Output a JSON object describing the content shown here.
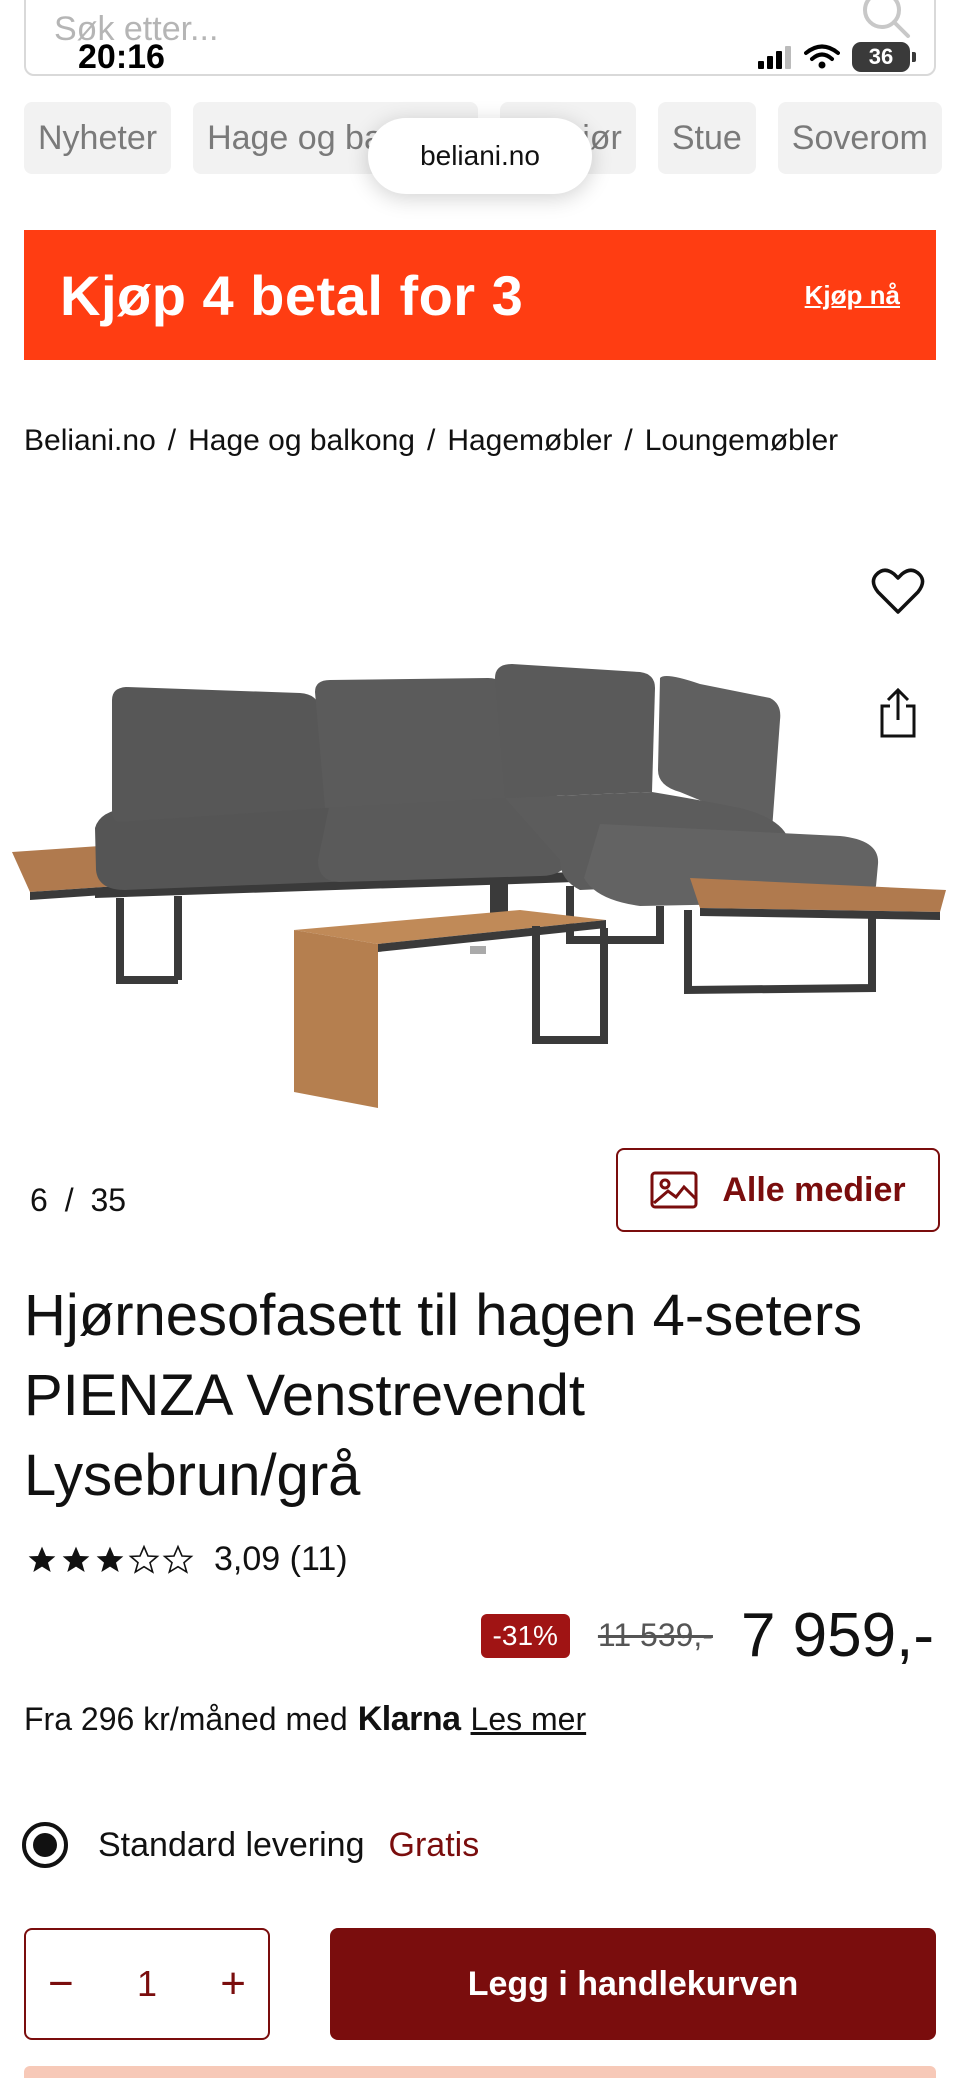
{
  "status_bar": {
    "time": "20:16",
    "battery": "36"
  },
  "search": {
    "placeholder": "Søk etter..."
  },
  "url_pill": "beliani.no",
  "categories": [
    "Nyheter",
    "Hage og balkong",
    "Interiør",
    "Stue",
    "Soverom"
  ],
  "promo": {
    "title": "Kjøp 4 betal for 3",
    "link": "Kjøp nå",
    "color": "#ff3d12"
  },
  "breadcrumb": [
    "Beliani.no",
    "Hage og balkong",
    "Hagemøbler",
    "Loungemøbler"
  ],
  "gallery": {
    "current": "6",
    "total": "35",
    "separator": "/",
    "media_label": "Alle medier"
  },
  "product": {
    "title": "Hjørnesofasett til hagen 4-seters PIENZA Venstrevendt Lysebrun/grå",
    "rating": {
      "value_text": "3,09 (11)",
      "stars": 3.09,
      "max": 5
    },
    "discount": "-31%",
    "old_price": "11 539,-",
    "price": "7 959,-",
    "klarna": {
      "prefix": "Fra 296 kr/måned med",
      "brand": "Klarna",
      "link": "Les mer"
    }
  },
  "delivery": {
    "label": "Standard levering",
    "price": "Gratis"
  },
  "quantity": {
    "value": "1",
    "minus": "−",
    "plus": "+"
  },
  "cart_button": "Legg i handlekurven",
  "colors": {
    "accent": "#7a0d0d",
    "discount_bg": "#a01414"
  }
}
